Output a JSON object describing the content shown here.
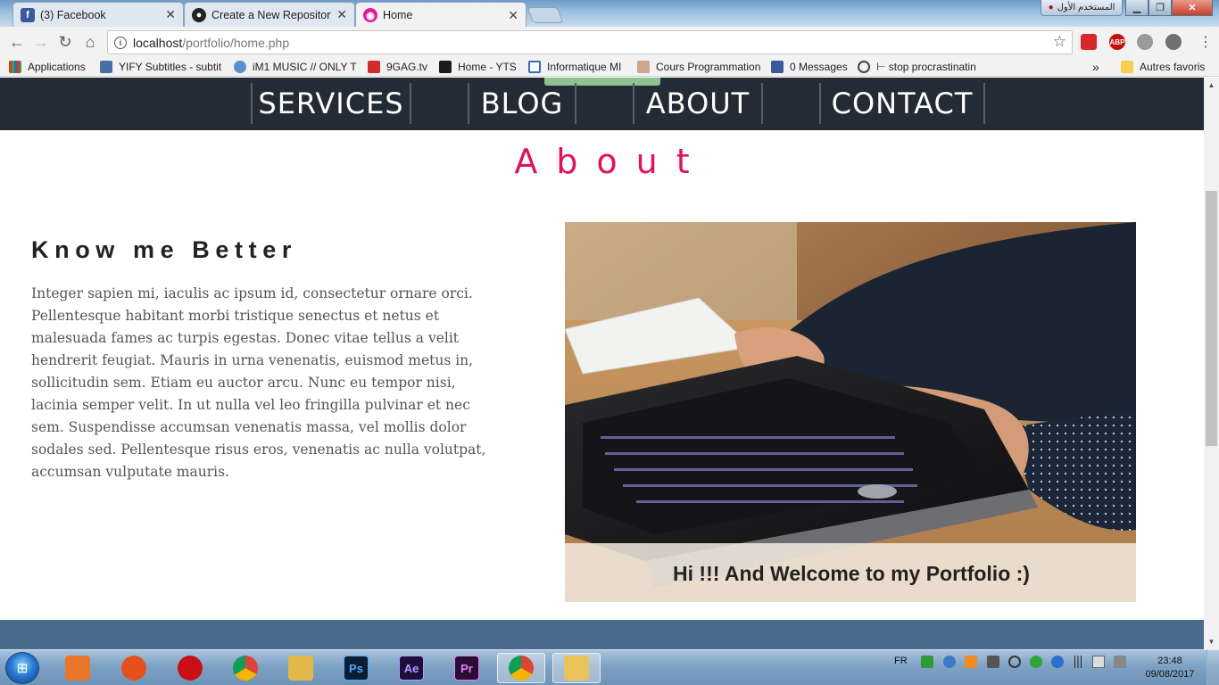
{
  "browser": {
    "tabs": [
      {
        "title": "(3) Facebook",
        "icon": "facebook-icon"
      },
      {
        "title": "Create a New Repository",
        "icon": "github-icon"
      },
      {
        "title": "Home",
        "icon": "page-icon",
        "active": true
      }
    ],
    "user_badge": "المستخدم الأول",
    "url_host": "localhost",
    "url_path": "/portfolio/home.php",
    "bookmarks": [
      {
        "label": "Applications",
        "icon": "apps-grid-icon"
      },
      {
        "label": "YIFY Subtitles - subtit",
        "icon": "yify-icon"
      },
      {
        "label": "iM1 MUSIC // ONLY T",
        "icon": "music-icon"
      },
      {
        "label": "9GAG.tv",
        "icon": "9gag-icon"
      },
      {
        "label": "Home - YTS",
        "icon": "yts-icon"
      },
      {
        "label": "Informatique MI",
        "icon": "doc-icon"
      },
      {
        "label": "Cours Programmation",
        "icon": "course-icon"
      },
      {
        "label": "0 Messages",
        "icon": "facebook-icon"
      },
      {
        "label": "⊢ stop procrastinatin",
        "icon": "link-icon"
      }
    ],
    "more_bookmarks_chevron": "»",
    "other_bookmarks": "Autres favoris",
    "extensions": [
      {
        "name": "pdf-extension-icon",
        "label": "",
        "color": "#d9262b"
      },
      {
        "name": "adblock-icon",
        "label": "ABP",
        "color": "#c70d0d"
      },
      {
        "name": "cloud-extension-icon",
        "label": "",
        "color": "#9a9a9a"
      },
      {
        "name": "no-script-icon",
        "label": "",
        "color": "#707070"
      }
    ]
  },
  "site": {
    "nav": [
      {
        "label": "SERVICES"
      },
      {
        "label": "BLOG"
      },
      {
        "label": "ABOUT"
      },
      {
        "label": "CONTACT"
      }
    ],
    "section_title": "About",
    "heading": "Know me Better",
    "paragraph": "Integer sapien mi, iaculis ac ipsum id, consectetur ornare orci. Pellentesque habitant morbi tristique senectus et netus et malesuada fames ac turpis egestas. Donec vitae tellus a velit hendrerit feugiat. Mauris in urna venenatis, euismod metus in, sollicitudin sem. Etiam eu auctor arcu. Nunc eu tempor nisi, lacinia semper velit. In ut nulla vel leo fringilla pulvinar et nec sem. Suspendisse accumsan venenatis massa, vel mollis dolor sodales sed. Pellentesque risus eros, venenatis ac nulla volutpat, accumsan vulputate mauris.",
    "photo_caption": "Hi !!! And Welcome to my Portfolio :)"
  },
  "taskbar": {
    "apps": [
      {
        "name": "media-player-icon",
        "label": "",
        "color": "#e8762b"
      },
      {
        "name": "firefox-icon",
        "label": "",
        "color": "#e5511a"
      },
      {
        "name": "opera-icon",
        "label": "",
        "color": "#cc0f16"
      },
      {
        "name": "chrome-icon",
        "label": "",
        "color": "#3a9a3a"
      },
      {
        "name": "file-explorer-icon",
        "label": "",
        "color": "#e3b84a"
      },
      {
        "name": "photoshop-icon",
        "label": "Ps",
        "color": "#0a1d33"
      },
      {
        "name": "after-effects-icon",
        "label": "Ae",
        "color": "#1d0f3a"
      },
      {
        "name": "premiere-icon",
        "label": "Pr",
        "color": "#2a0d33"
      },
      {
        "name": "chrome-running-icon",
        "label": "",
        "color": "#3a9a3a"
      },
      {
        "name": "paint-icon",
        "label": "",
        "color": "#e9c25a"
      }
    ],
    "language": "FR",
    "time": "23:48",
    "date": "09/08/2017"
  }
}
